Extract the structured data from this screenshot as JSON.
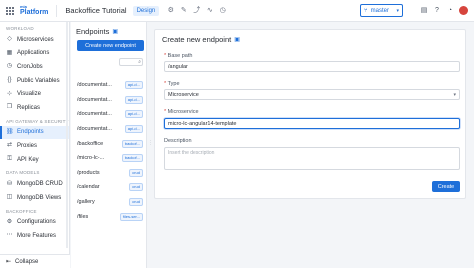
{
  "topbar": {
    "logo_small": "mia",
    "logo_text": "Platform",
    "project_title": "Backoffice Tutorial",
    "mode_label": "Design",
    "branch": "master"
  },
  "sidebar": {
    "sections": [
      {
        "title": "Workload",
        "items": [
          {
            "label": "Microservices",
            "icon": "cube-icon"
          },
          {
            "label": "Applications",
            "icon": "apps-icon"
          },
          {
            "label": "CronJobs",
            "icon": "clock-icon"
          },
          {
            "label": "Public Variables",
            "icon": "variables-icon"
          },
          {
            "label": "Visualize",
            "icon": "graph-icon"
          },
          {
            "label": "Replicas",
            "icon": "replicas-icon"
          }
        ]
      },
      {
        "title": "API Gateway & Security",
        "items": [
          {
            "label": "Endpoints",
            "icon": "link-icon",
            "active": true
          },
          {
            "label": "Proxies",
            "icon": "proxy-icon"
          },
          {
            "label": "API Key",
            "icon": "key-icon"
          }
        ]
      },
      {
        "title": "Data Models",
        "items": [
          {
            "label": "MongoDB CRUD",
            "icon": "database-icon"
          },
          {
            "label": "MongoDB Views",
            "icon": "views-icon"
          }
        ]
      },
      {
        "title": "Backoffice",
        "items": [
          {
            "label": "Configurations",
            "icon": "settings-icon"
          },
          {
            "label": "More Features",
            "icon": "more-icon"
          }
        ]
      }
    ],
    "collapse_label": "Collapse"
  },
  "endpoints_panel": {
    "title": "Endpoints",
    "create_button": "Create new endpoint",
    "rows": [
      {
        "path": "/documentat...",
        "tag": "api-d..."
      },
      {
        "path": "/documentat...",
        "tag": "api-d..."
      },
      {
        "path": "/documentat...",
        "tag": "api-d..."
      },
      {
        "path": "/documentat...",
        "tag": "api-d..."
      },
      {
        "path": "/backoffice",
        "tag": "backof..."
      },
      {
        "path": "/micro-lc-...",
        "tag": "backof..."
      },
      {
        "path": "/products",
        "tag": "crud"
      },
      {
        "path": "/calendar",
        "tag": "crud"
      },
      {
        "path": "/gallery",
        "tag": "crud"
      },
      {
        "path": "/files",
        "tag": "files-ser..."
      }
    ]
  },
  "form": {
    "title": "Create new endpoint",
    "base_path_label": "Base path",
    "base_path_value": "/angular",
    "type_label": "Type",
    "type_value": "Microservice",
    "microservice_label": "Microservice",
    "microservice_value": "micro-lc-angular14-template",
    "description_label": "Description",
    "description_placeholder": "Insert the description",
    "submit_label": "Create"
  },
  "colors": {
    "accent": "#1e6fd9",
    "required": "#d6453d"
  }
}
